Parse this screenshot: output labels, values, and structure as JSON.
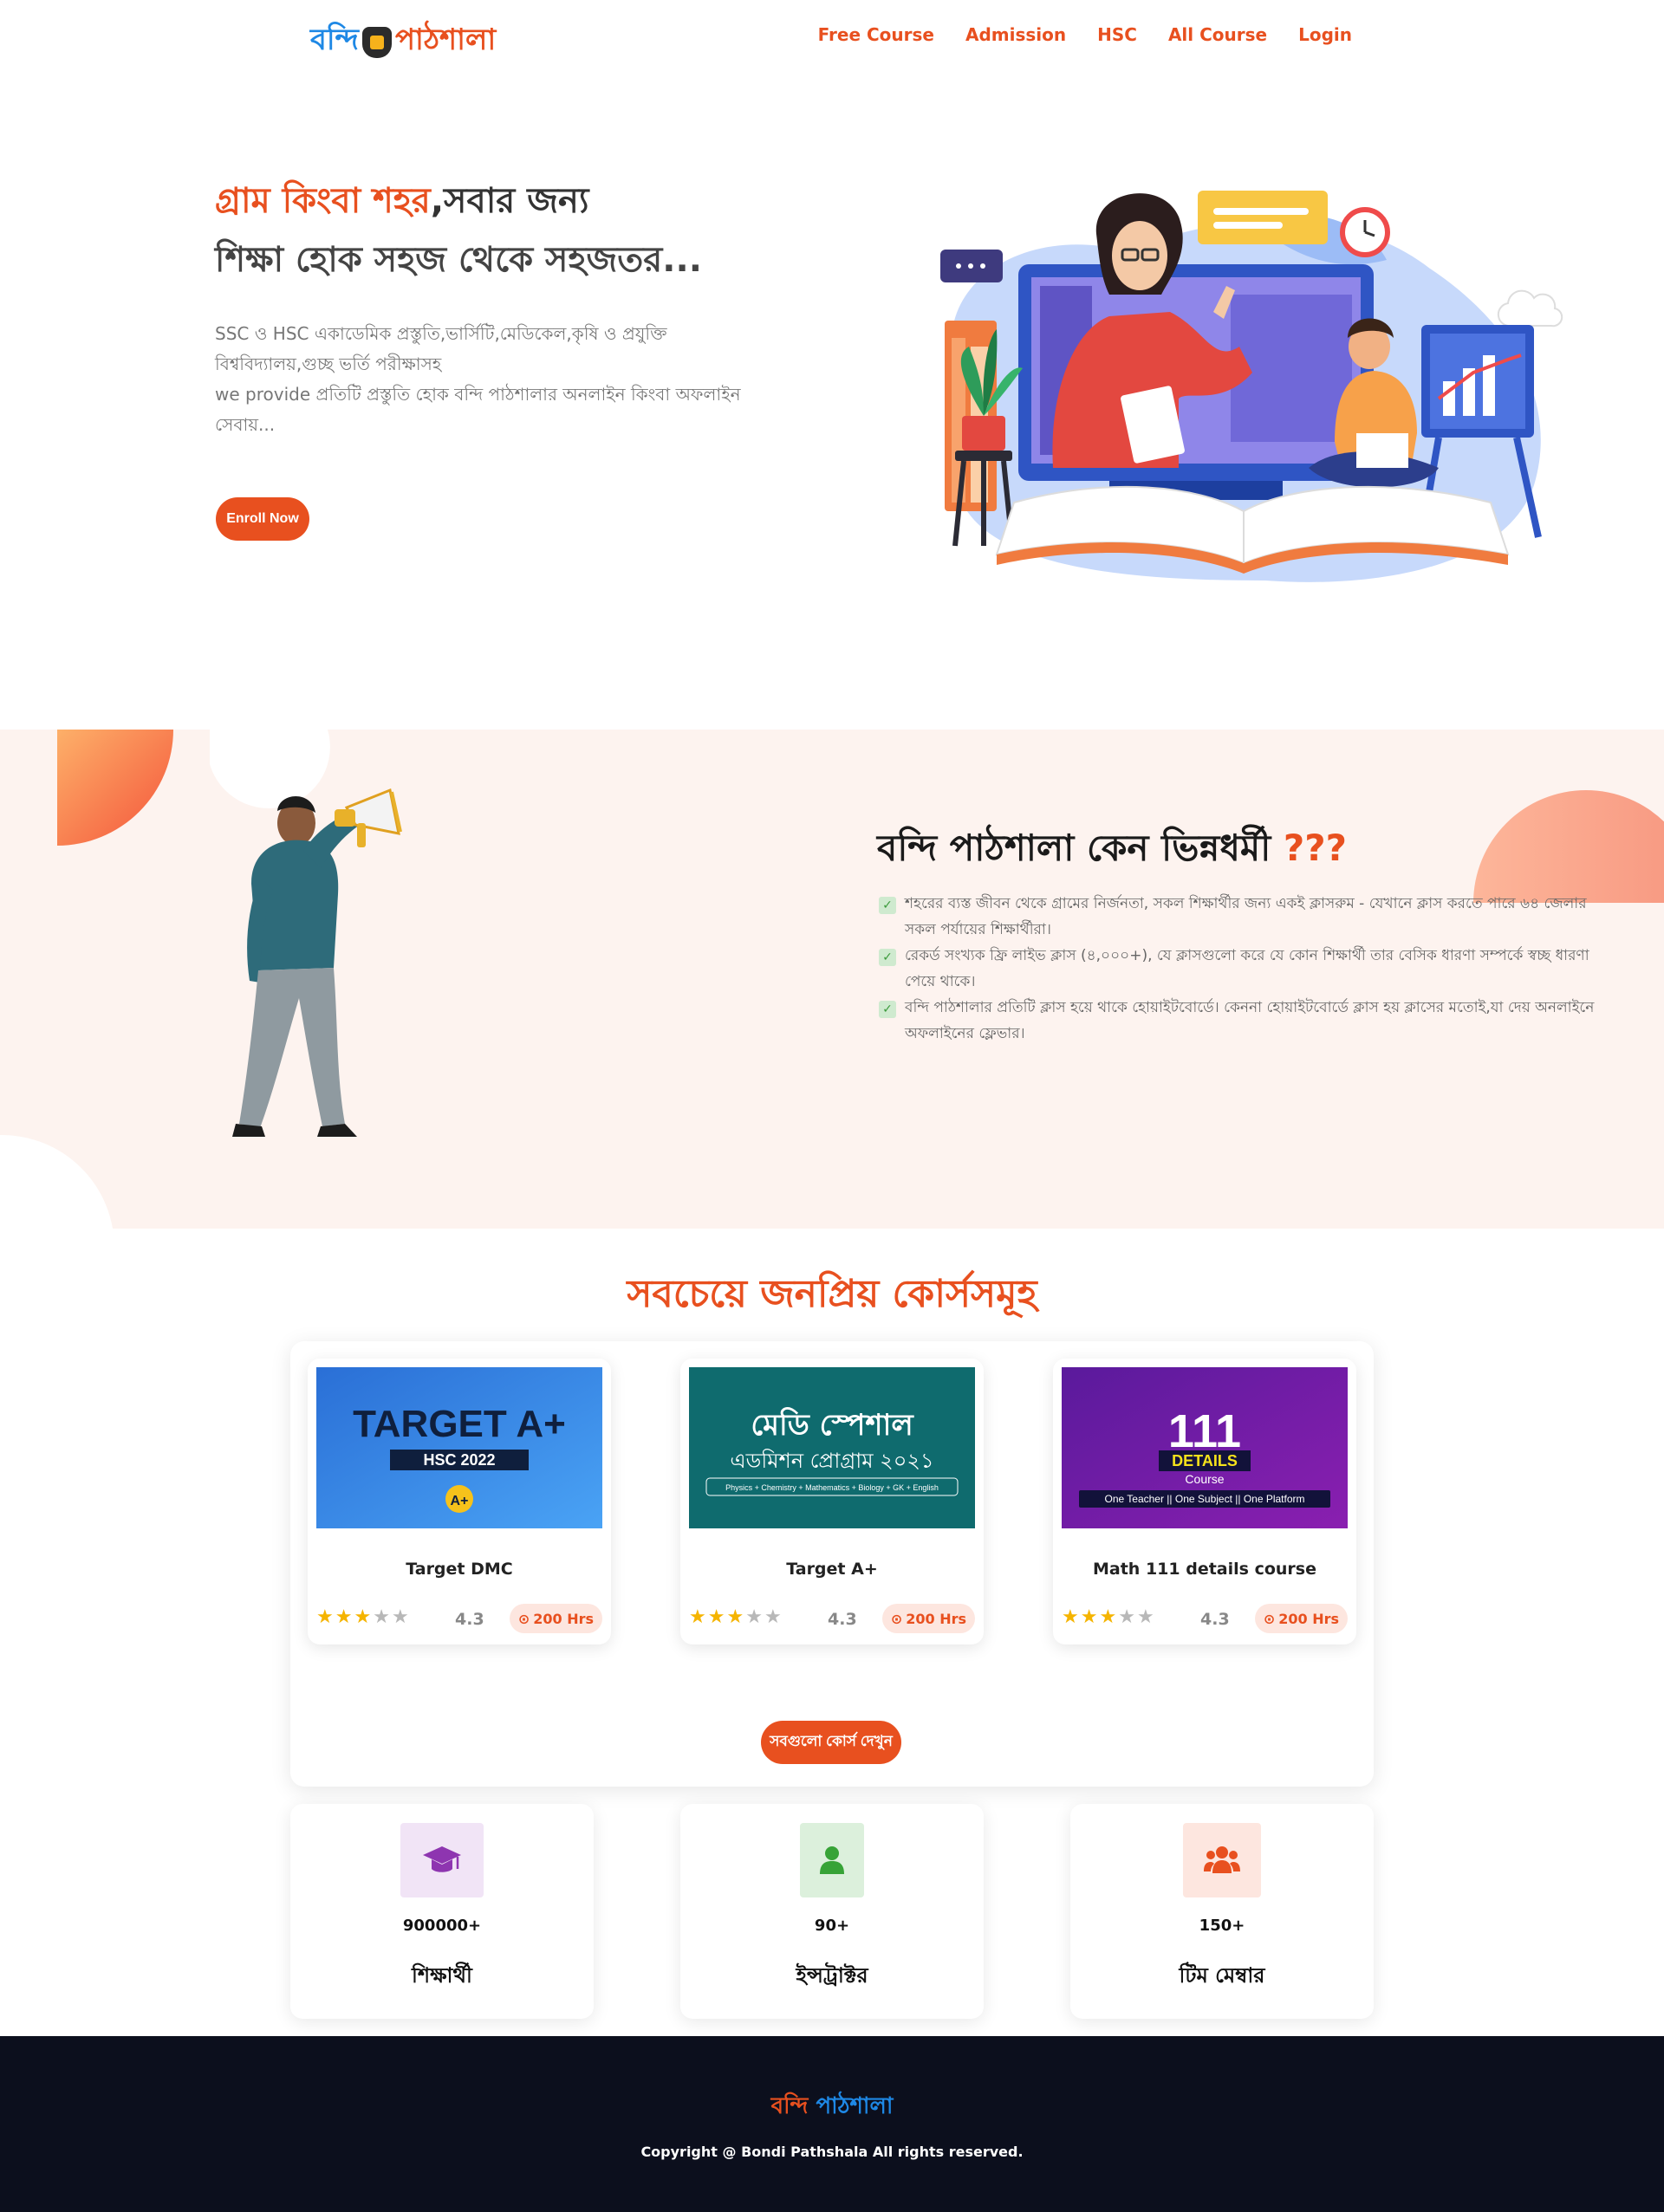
{
  "nav": {
    "logo_part1": "বন্দি",
    "logo_part2": "পাঠশালা",
    "items": [
      "Free Course",
      "Admission",
      "HSC",
      "All Course",
      "Login"
    ]
  },
  "hero": {
    "title_highlight": "গ্রাম কিংবা শহর",
    "title_rest": ",সবার জন্য",
    "title_line2": "শিক্ষা হোক সহজ থেকে সহজতর...",
    "desc_line1": "SSC ও HSC একাডেমিক প্রস্তুতি,ভার্সিটি,মেডিকেল,কৃষি ও প্রযুক্তি",
    "desc_line2": "বিশ্ববিদ্যালয়,গুচ্ছ ভর্তি পরীক্ষাসহ",
    "desc_line3": "we provide প্রতিটি প্রস্তুতি হোক বন্দি পাঠশালার অনলাইন কিংবা অফলাইন",
    "desc_line4": "সেবায়...",
    "enroll_label": "Enroll Now"
  },
  "why": {
    "title": "বন্দি পাঠশালা কেন ভিন্নধর্মী",
    "title_marks": "???",
    "points": [
      "শহরের ব্যস্ত জীবন থেকে গ্রামের নির্জনতা, সকল শিক্ষার্থীর জন্য একই ক্লাসরুম - যেখানে ক্লাস করতে পারে ৬৪ জেলার সকল পর্যায়ের শিক্ষার্থীরা।",
      "রেকর্ড সংখ্যক ফ্রি লাইভ ক্লাস (৪,০০০+), যে ক্লাসগুলো করে যে কোন শিক্ষার্থী তার বেসিক ধারণা সম্পর্কে স্বচ্ছ ধারণা পেয়ে থাকে।",
      "বন্দি পাঠশালার প্রতিটি ক্লাস হয়ে থাকে হোয়াইটবোর্ডে। কেননা হোয়াইটবোর্ডে ক্লাস হয় ক্লাসের মতোই,যা দেয় অনলাইনে অফলাইনের ফ্লেভার।"
    ]
  },
  "popular": {
    "title": "সবচেয়ে জনপ্রিয় কোর্সসমূহ",
    "courses": [
      {
        "name": "Target DMC",
        "rating": "4.3",
        "stars": 3,
        "hours": "200 Hrs",
        "thumb_title": "TARGET A+",
        "thumb_sub": "HSC 2022",
        "thumb_mark": "A+"
      },
      {
        "name": "Target A+",
        "rating": "4.3",
        "stars": 3,
        "hours": "200 Hrs",
        "thumb_title": "মেডি স্পেশাল",
        "thumb_sub": "এডমিশন প্রোগ্রাম ২০২১",
        "thumb_note": "Physics + Chemistry + Mathematics + Biology + GK + English"
      },
      {
        "name": "Math 111 details course",
        "rating": "4.3",
        "stars": 3,
        "hours": "200 Hrs",
        "thumb_title": "111",
        "thumb_sub": "DETAILS",
        "thumb_sub2": "Course",
        "thumb_note": "One Teacher || One Subject || One Platform"
      }
    ],
    "see_all_label": "সবগুলো কোর্স দেখুন"
  },
  "stats": [
    {
      "value": "900000+",
      "label": "শিক্ষার্থী",
      "icon": "graduation-cap-icon",
      "bg": "#f1e4f6",
      "color": "#8e35b0"
    },
    {
      "value": "90+",
      "label": "ইন্সট্রাক্টর",
      "icon": "user-icon",
      "bg": "#dcf0dc",
      "color": "#37a337"
    },
    {
      "value": "150+",
      "label": "টিম মেম্বার",
      "icon": "users-icon",
      "bg": "#fde6df",
      "color": "#e8501f"
    }
  ],
  "footer": {
    "brand1": "বন্দি",
    "brand2": "পাঠশালা",
    "copyright": "Copyright @ Bondi Pathshala All rights reserved."
  },
  "colors": {
    "accent": "#e8501f",
    "brand_blue": "#1e88e5",
    "why_bg": "#fdf3ef",
    "footer_bg": "#0c0f1d"
  }
}
